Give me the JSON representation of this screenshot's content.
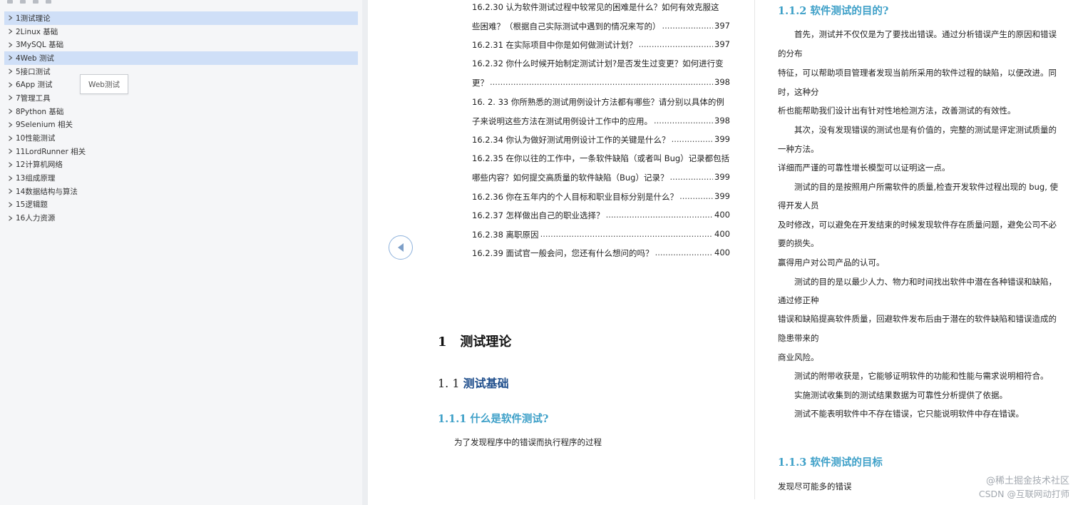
{
  "sidebar": {
    "tooltip": "Web测试",
    "items": [
      {
        "label": "1测试理论",
        "highlighted": true
      },
      {
        "label": "2Linux  基础",
        "highlighted": false
      },
      {
        "label": "3MySQL 基础",
        "highlighted": false
      },
      {
        "label": "4Web 测试",
        "highlighted": true
      },
      {
        "label": "5接口测试",
        "highlighted": false
      },
      {
        "label": "6App  测试",
        "highlighted": false
      },
      {
        "label": "7管理工具",
        "highlighted": false
      },
      {
        "label": "8Python  基础",
        "highlighted": false
      },
      {
        "label": "9Selenium  相关",
        "highlighted": false
      },
      {
        "label": "10性能测试",
        "highlighted": false
      },
      {
        "label": "11LordRunner 相关",
        "highlighted": false
      },
      {
        "label": "12计算机网络",
        "highlighted": false
      },
      {
        "label": "13组成原理",
        "highlighted": false
      },
      {
        "label": "14数据结构与算法",
        "highlighted": false
      },
      {
        "label": "15逻辑题",
        "highlighted": false
      },
      {
        "label": "16人力资源",
        "highlighted": false
      }
    ]
  },
  "toc": {
    "e1_line1": "16.2.30  认为软件测试过程中较常见的困难是什么？如何有效克服这",
    "e1_line2": "些困难？（根据自己实际测试中遇到的情况来写的）",
    "e1_page": "397",
    "e2": "16.2.31  在实际项目中你是如何做测试计划？",
    "e2_page": "397",
    "e3_line1": "16.2.32  你什么时候开始制定测试计划?是否发生过变更？如何进行变",
    "e3_line2": "更？",
    "e3_page": "398",
    "e4_line1": "16. 2. 33  你所熟悉的测试用例设计方法都有哪些？请分别以具体的例",
    "e4_line2": "子来说明这些方法在测试用例设计工作中的应用。",
    "e4_page": "398",
    "e5": "16.2.34  你认为做好测试用例设计工作的关键是什么？",
    "e5_page": "399",
    "e6_line1": "16.2.35  在你以往的工作中，一条软件缺陷（或者叫 Bug）记录都包括",
    "e6_line2": "哪些内容？如何提交高质量的软件缺陷（Bug）记录？",
    "e6_page": "399",
    "e7": "16.2.36  你在五年内的个人目标和职业目标分别是什么？",
    "e7_page": "399",
    "e8": "16.2.37  怎样做出自己的职业选择？",
    "e8_page": "400",
    "e9": "16.2.38  离职原因",
    "e9_page": "400",
    "e10": "16.2.39  面试官一般会问，您还有什么想问的吗？",
    "e10_page": "400"
  },
  "left_page": {
    "h1_num": "1",
    "h1_title": "测试理论",
    "h2_num": "1. 1",
    "h2_title": "测试基础",
    "h3_title": "1.1.1  什么是软件测试?",
    "para": "为了发现程序中的错误而执行程序的过程"
  },
  "right_page": {
    "h3a": "1.1.2  软件测试的目的?",
    "lines": [
      "首先，测试并不仅仅是为了要找出错误。通过分析错误产生的原因和错误",
      "的分布",
      "特征，可以帮助项目管理者发现当前所采用的软件过程的缺陷，以便改进。同",
      "时，这种分",
      "析也能帮助我们设计出有针对性地检测方法，改善测试的有效性。",
      "其次，没有发现错误的测试也是有价值的，完整的测试是评定测试质量的",
      "一种方法。",
      "详细而严谨的可靠性增长模型可以证明这一点。",
      "测试的目的是按照用户所需软件的质量,检查开发软件过程出现的 bug, 使",
      "得开发人员",
      "及时修改，可以避免在开发结束的时候发现软件存在质量问题，避免公司不必",
      "要的损失。",
      "赢得用户对公司产品的认可。",
      "测试的目的是以最少人力、物力和时间找出软件中潜在各种错误和缺陷，",
      "通过修正种",
      "错误和缺陷提高软件质量，回避软件发布后由于潜在的软件缺陷和错误造成的",
      "隐患带来的",
      "商业风险。",
      "测试的附带收获是，它能够证明软件的功能和性能与需求说明相符合。",
      "实施测试收集到的测试结果数据为可靠性分析提供了依据。",
      "测试不能表明软件中不存在错误，它只能说明软件中存在错误。"
    ],
    "h3b": "1.1.3  软件测试的目标",
    "last_para": "发现尽可能多的错误"
  },
  "watermark": {
    "line1": "@稀土掘金技术社区",
    "line2": "CSDN @互联网动打师"
  },
  "colors": {
    "highlight": "#cfdff7",
    "heading_blue": "#3ea0c8",
    "heading_dark_blue": "#1f4e8c"
  },
  "icons": {
    "outline_toggle": "chevron-right-icon",
    "nav_back": "triangle-left-icon"
  }
}
